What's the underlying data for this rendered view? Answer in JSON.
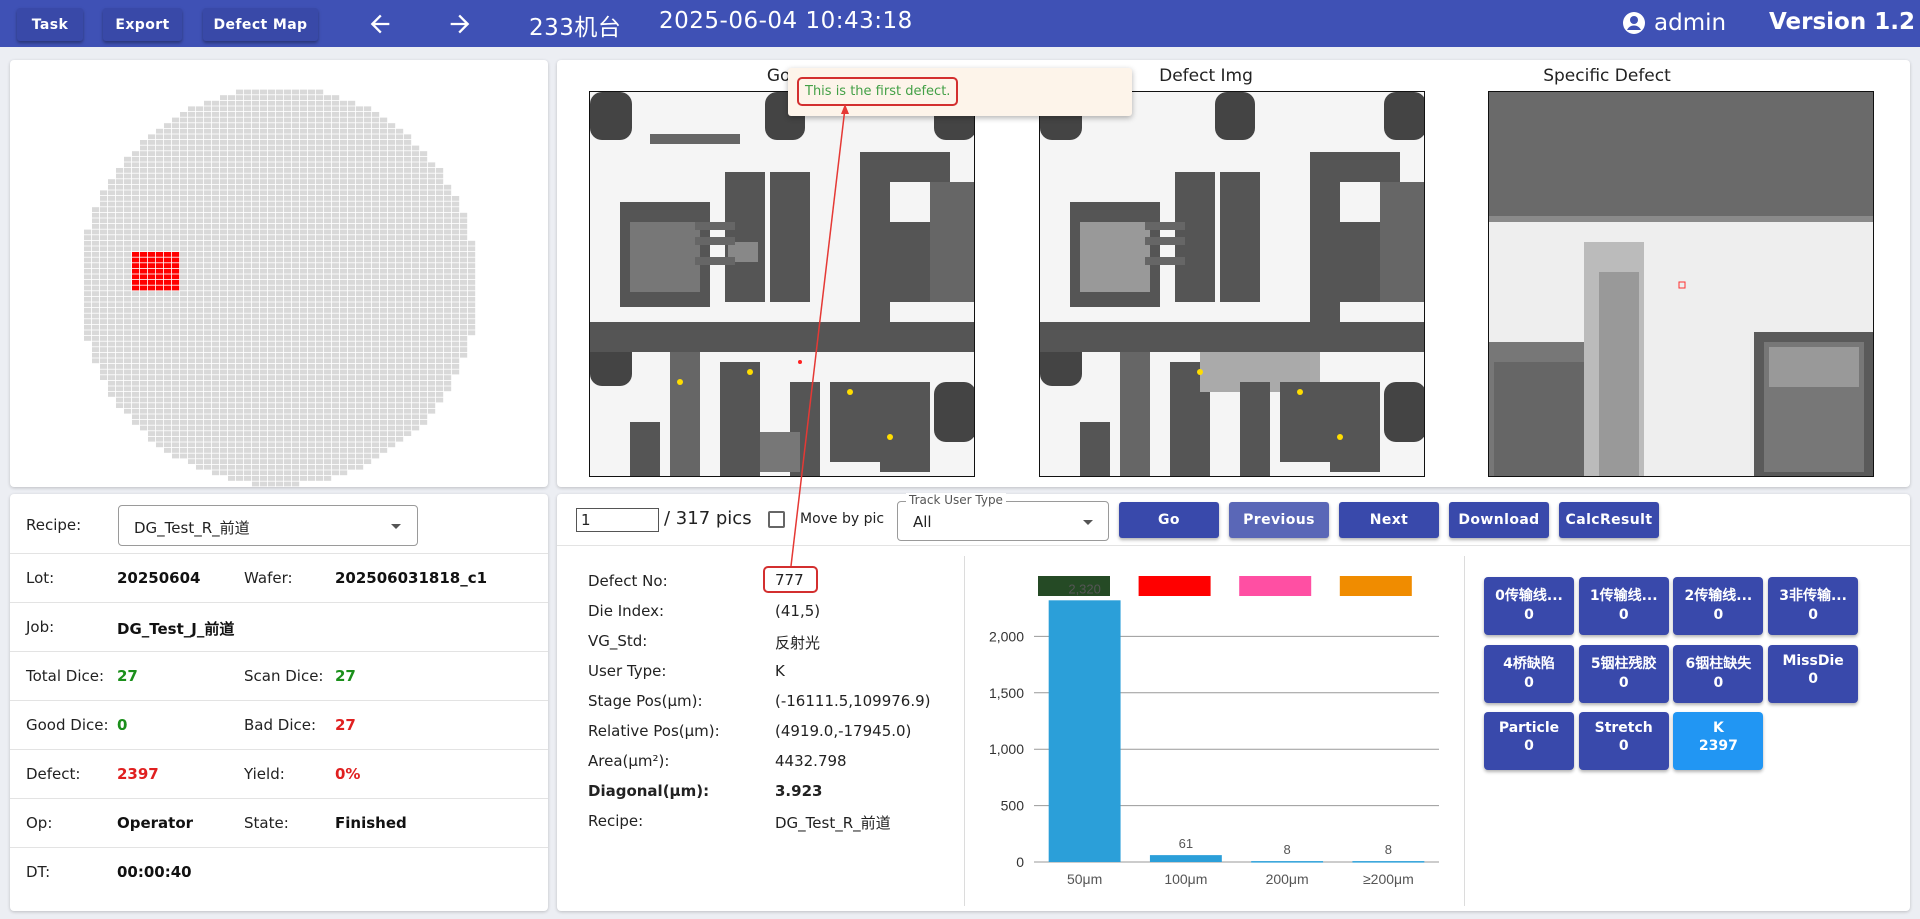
{
  "topbar": {
    "task_label": "Task",
    "export_label": "Export",
    "defect_map_label": "Defect Map",
    "machine": "233机台",
    "datetime": "2025-06-04 10:43:18",
    "user": "admin",
    "version": "Version 1.2"
  },
  "wafer": {
    "highlight_color": "#ff0000",
    "die_color": "#d9d9d9"
  },
  "images": {
    "golden_title": "Golden",
    "defect_title": "Defect Img",
    "specific_title": "Specific Defect"
  },
  "tooltip": {
    "text": "This is the first defect."
  },
  "info": {
    "recipe_label": "Recipe:",
    "recipe_value": "DG_Test_R_前道",
    "lot_label": "Lot:",
    "lot_value": "20250604",
    "wafer_label": "Wafer:",
    "wafer_value": "202506031818_c1",
    "job_label": "Job:",
    "job_value": "DG_Test_J_前道",
    "total_dice_label": "Total Dice:",
    "total_dice_value": "27",
    "scan_dice_label": "Scan Dice:",
    "scan_dice_value": "27",
    "good_dice_label": "Good Dice:",
    "good_dice_value": "0",
    "bad_dice_label": "Bad Dice:",
    "bad_dice_value": "27",
    "defect_label": "Defect:",
    "defect_value": "2397",
    "yield_label": "Yield:",
    "yield_value": "0%",
    "op_label": "Op:",
    "op_value": "Operator",
    "state_label": "State:",
    "state_value": "Finished",
    "dt_label": "DT:",
    "dt_value": "00:00:40"
  },
  "toolbar": {
    "page_value": "1",
    "total_pics": "/ 317 pics",
    "move_by_pic": "Move by pic",
    "track_label": "Track User Type",
    "track_value": "All",
    "go": "Go",
    "previous": "Previous",
    "next": "Next",
    "download": "Download",
    "calc": "CalcResult"
  },
  "defect": {
    "defect_no_label": "Defect No:",
    "defect_no": "777",
    "die_index_label": "Die Index:",
    "die_index": "(41,5)",
    "vg_std_label": "VG_Std:",
    "vg_std": "反射光",
    "user_type_label": "User Type:",
    "user_type": "K",
    "stage_pos_label": "Stage Pos(μm):",
    "stage_pos": "(-16111.5,109976.9)",
    "relative_pos_label": "Relative Pos(μm):",
    "relative_pos": "(4919.0,-17945.0)",
    "area_label": "Area(μm²):",
    "area": "4432.798",
    "diagonal_label": "Diagonal(μm):",
    "diagonal": "3.923",
    "recipe_label": "Recipe:",
    "recipe": "DG_Test_R_前道"
  },
  "chart_data": {
    "type": "bar",
    "categories": [
      "50μm",
      "100μm",
      "200μm",
      "≥200μm"
    ],
    "values": [
      2320,
      61,
      8,
      8
    ],
    "value_labels": [
      "2,320",
      "61",
      "8",
      "8"
    ],
    "legend_colors": [
      "#254a25",
      "#ff0000",
      "#ff4fa3",
      "#f08c00"
    ],
    "bar_color": "#2b9fd9",
    "yticks": [
      "0",
      "500",
      "1,000",
      "1,500",
      "2,000"
    ],
    "ylim": [
      0,
      2500
    ],
    "grid": true,
    "legend_position": "top"
  },
  "categories": [
    {
      "name": "0传输线...",
      "count": "0"
    },
    {
      "name": "1传输线...",
      "count": "0"
    },
    {
      "name": "2传输线...",
      "count": "0"
    },
    {
      "name": "3非传输...",
      "count": "0"
    },
    {
      "name": "4桥缺陷",
      "count": "0"
    },
    {
      "name": "5铟柱残胶",
      "count": "0"
    },
    {
      "name": "6铟柱缺失",
      "count": "0"
    },
    {
      "name": "MissDie",
      "count": "0"
    },
    {
      "name": "Particle",
      "count": "0"
    },
    {
      "name": "Stretch",
      "count": "0"
    },
    {
      "name": "K",
      "count": "2397"
    }
  ]
}
